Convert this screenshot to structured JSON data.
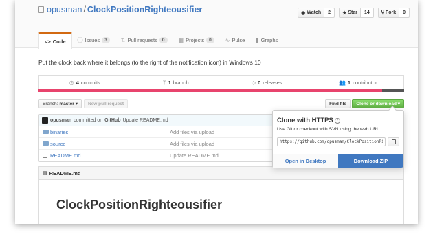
{
  "repo": {
    "owner": "opusman",
    "separator": "/",
    "name": "ClockPositionRighteousifier"
  },
  "actions": [
    {
      "key": "watch",
      "icon": "eye-icon",
      "glyph": "◉",
      "label": "Watch",
      "count": "2"
    },
    {
      "key": "star",
      "icon": "star-icon",
      "glyph": "★",
      "label": "Star",
      "count": "14"
    },
    {
      "key": "fork",
      "icon": "fork-icon",
      "glyph": "Ⴤ",
      "label": "Fork",
      "count": "0"
    }
  ],
  "tabs": [
    {
      "key": "code",
      "glyph": "<>",
      "label": "Code",
      "count": "",
      "selected": true
    },
    {
      "key": "issues",
      "glyph": "ⓘ",
      "label": "Issues",
      "count": "3",
      "selected": false
    },
    {
      "key": "pulls",
      "glyph": "⇅",
      "label": "Pull requests",
      "count": "0",
      "selected": false
    },
    {
      "key": "projects",
      "glyph": "▦",
      "label": "Projects",
      "count": "0",
      "selected": false
    },
    {
      "key": "pulse",
      "glyph": "∿",
      "label": "Pulse",
      "count": "",
      "selected": false
    },
    {
      "key": "graphs",
      "glyph": "▮",
      "label": "Graphs",
      "count": "",
      "selected": false
    }
  ],
  "description": "Put the clock back where it belongs (to the right of the notification icon) in Windows 10",
  "summary": {
    "commits": {
      "count": "4",
      "label": "commits"
    },
    "branches": {
      "count": "1",
      "label": "branch"
    },
    "releases": {
      "count": "0",
      "label": "releases"
    },
    "contributors": {
      "count": "1",
      "label": "contributor"
    }
  },
  "language_bar": [
    {
      "share": 0.94,
      "color": "#e8446d"
    },
    {
      "share": 0.06,
      "color": "#555555"
    }
  ],
  "filebar": {
    "branch_prefix": "Branch:",
    "branch": "master",
    "new_pr": "New pull request",
    "find_file": "Find file",
    "clone": "Clone or download"
  },
  "commit": {
    "author": "opusman",
    "verb": "committed on",
    "platform": "GitHub",
    "message": "Update README.md"
  },
  "files": [
    {
      "type": "dir",
      "name": "binaries",
      "message": "Add files via upload"
    },
    {
      "type": "dir",
      "name": "source",
      "message": "Add files via upload"
    },
    {
      "type": "file",
      "name": "README.md",
      "message": "Update README.md"
    }
  ],
  "readme": {
    "header": "README.md",
    "title": "ClockPositionRighteousifier"
  },
  "clone_popover": {
    "title": "Clone with HTTPS",
    "help": "?",
    "subtitle": "Use Git or checkout with SVN using the web URL.",
    "url": "https://github.com/opusman/ClockPositionRighteousifier.git",
    "open_desktop": "Open in Desktop",
    "download_zip": "Download ZIP"
  },
  "colors": {
    "link": "#4078c0",
    "tab_accent": "#d26911",
    "clone_green": "#60b044"
  }
}
